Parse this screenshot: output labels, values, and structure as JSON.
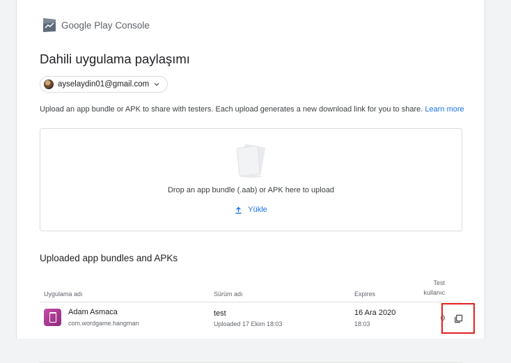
{
  "brand": {
    "google": "Google Play",
    "console": "Console"
  },
  "page_title": "Dahili uygulama paylaşımı",
  "account": {
    "email": "ayselaydin01@gmail.com"
  },
  "description": {
    "text": "Upload an app bundle or APK to share with testers. Each upload generates a new download link for you to share. ",
    "link": "Learn more"
  },
  "dropzone": {
    "text": "Drop an app bundle (.aab) or APK here to upload",
    "upload_label": "Yükle"
  },
  "section_title": "Uploaded app bundles and APKs",
  "table": {
    "headers": {
      "app": "Uygulama adı",
      "version": "Sürüm adı",
      "expires": "Expires",
      "users_line1": "Test",
      "users_line2": "kullanıc"
    },
    "rows": [
      {
        "app_name": "Adam Asmaca",
        "package": "com.wordgame.hangman",
        "version": "test",
        "uploaded": "Uploaded 17 Ekim 18:03",
        "expires_date": "16 Ara 2020",
        "expires_time": "18:03",
        "users": "0"
      }
    ]
  },
  "colors": {
    "accent": "#1a73e8",
    "highlight": "#e02020"
  }
}
